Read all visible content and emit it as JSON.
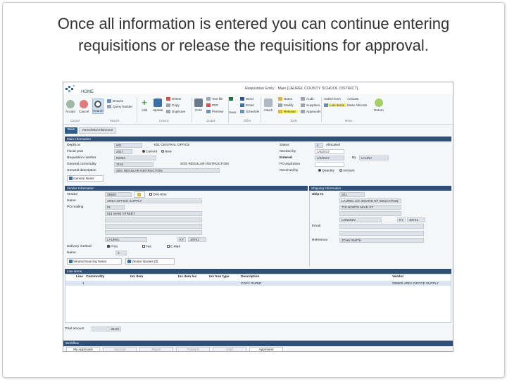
{
  "slide": {
    "title": "Once all information is entered you can continue entering requisitions or release the requisitions for approval."
  },
  "app": {
    "home_tab": "HOME",
    "window_title": "Requisition Entry · Main [LAUREL COUNTY SCHOOL DISTRICT]"
  },
  "ribbon": {
    "accept": "Accept",
    "cancel": "Cancel",
    "search": "Search",
    "browse": "Browse",
    "query_builder": "Query Builder",
    "add": "Add",
    "update": "Update",
    "delete": "Delete",
    "copy": "Copy",
    "duplicate": "Duplicate",
    "print": "Print",
    "text_file": "Text file",
    "pdf": "PDF",
    "preview": "Preview",
    "word": "Word",
    "email": "Email",
    "excel": "Excel",
    "schedule": "Schedule",
    "save": "Save",
    "attach": "Attach",
    "notes": "Notes",
    "modify": "Modify",
    "release": "Release",
    "audit": "Audit",
    "suppliers": "Suppliers",
    "approvals": "Approvals",
    "switch_form": "Switch form",
    "line_items": "Line items",
    "activate": "Activate",
    "mass_allocate": "Mass Allocate",
    "return": "Return",
    "groups": {
      "cancel": "Cancel",
      "search": "Search",
      "actions": "Actions",
      "output": "Output",
      "office": "Office",
      "tools": "Tools",
      "menu": "Menu"
    }
  },
  "tabs": {
    "main": "Main",
    "miscellaneous": "Items/Miscellaneous"
  },
  "main_info": {
    "header": "Main information",
    "dept_loc_label": "Dept/Loc",
    "dept_loc_code": "001",
    "dept_loc_name": "001 CENTRAL OFFICE",
    "fiscal_year_label": "Fiscal year",
    "fiscal_year": "2017",
    "current_label": "Current",
    "new_label": "New",
    "requisition_number_label": "Requisition number",
    "requisition_number": "00003",
    "general_commodity_label": "General commodity",
    "general_commodity_code": "3116",
    "general_commodity_name": "SOS REGULAR INSTRUCTION",
    "general_description_label": "General description",
    "general_description": "SEC REGULAR INSTRUCTION",
    "general_notes_button": "General Notes",
    "status_label": "Status",
    "status_code": "4",
    "status_value": "Allocated",
    "needed_by_label": "Needed by",
    "needed_by": "1/4/2017",
    "entered_label": "Entered",
    "entered": "1/4/2017",
    "entered_by_label": "By",
    "entered_by": "LAURA",
    "po_expiration_label": "PO expiration",
    "received_by_label": "Received by",
    "quantity_label": "Quantity",
    "amount_label": "Amount"
  },
  "vendor": {
    "header": "Vendor Information",
    "vendor_label": "Vendor",
    "vendor_code": "35600",
    "one_time_label": "One-time",
    "name_label": "Name",
    "name": "AREA OFFICE SUPPLY",
    "po_mailing_label": "PO mailing",
    "po_mailing_code": "01",
    "address_line": "521 MAIN STREET",
    "city": "LAUREL",
    "state": "KY",
    "zip": "40701",
    "delivery_label": "Delivery method",
    "print_label": "Print",
    "fax_label": "Fax",
    "email_label": "E-Mail",
    "name2_label": "Name",
    "name2_value": "0",
    "vendor_notes_button": "Vendor/Sourcing Notes",
    "vendor_quotes_button": "Vendor Quotes (0)"
  },
  "shipping": {
    "header": "Shipping Information",
    "ship_to_label": "Ship to",
    "ship_to_code": "001",
    "ship_name": "LAUREL CO. BOARD OF EDUCATION",
    "ship_address": "718 NORTH MAIN ST",
    "ship_city": "LONDON",
    "ship_state": "KY",
    "ship_zip": "40741",
    "email_label": "Email",
    "reference_label": "Reference",
    "reference": "JOHN SMITH"
  },
  "line_items": {
    "header": "Line items",
    "columns": [
      "Line",
      "Commodity",
      "Inv item",
      "Inv item loc",
      "Inv tran type",
      "Description",
      "Vendor"
    ],
    "rows": [
      {
        "line": "1",
        "commodity": "",
        "inv_item": "",
        "inv_item_loc": "",
        "inv_tran_type": "",
        "description": "COPY PAPER",
        "vendor": "035600 AREA OFFICE SUPPLY"
      }
    ],
    "total_label": "Total amount",
    "total_value": "26.00"
  },
  "workflow": {
    "header": "Workflow",
    "buttons": [
      "My Approvals",
      "Approve",
      "Reject",
      "Forward",
      "Hold",
      "Approvers"
    ]
  },
  "colors": {
    "header": "#2f4f77",
    "accent": "#3a6ea5",
    "grid_row": "#dbe6f5"
  }
}
